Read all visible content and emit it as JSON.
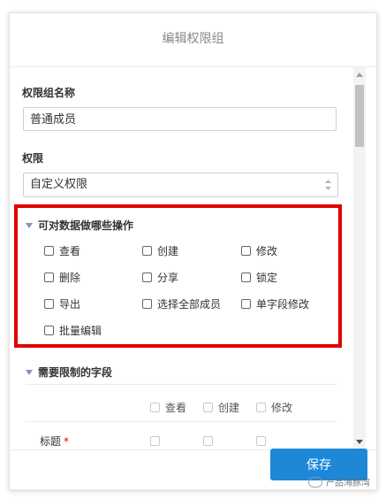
{
  "dialog": {
    "title": "编辑权限组"
  },
  "form": {
    "group_name_label": "权限组名称",
    "group_name_value": "普通成员",
    "permission_label": "权限",
    "permission_value": "自定义权限"
  },
  "operations_section": {
    "title": "可对数据做哪些操作",
    "options": [
      "查看",
      "创建",
      "修改",
      "删除",
      "分享",
      "锁定",
      "导出",
      "选择全部成员",
      "单字段修改",
      "批量编辑"
    ]
  },
  "fields_section": {
    "title": "需要限制的字段",
    "columns": [
      "查看",
      "创建",
      "修改"
    ],
    "rows": [
      {
        "label": "标题",
        "required_mark": "*"
      }
    ]
  },
  "footer": {
    "save_label": "保存"
  },
  "watermark": {
    "text": "产品海豚湾"
  },
  "colors": {
    "primary": "#1d88d8",
    "highlight": "#e00000",
    "section_triangle": "#7f95b8"
  }
}
